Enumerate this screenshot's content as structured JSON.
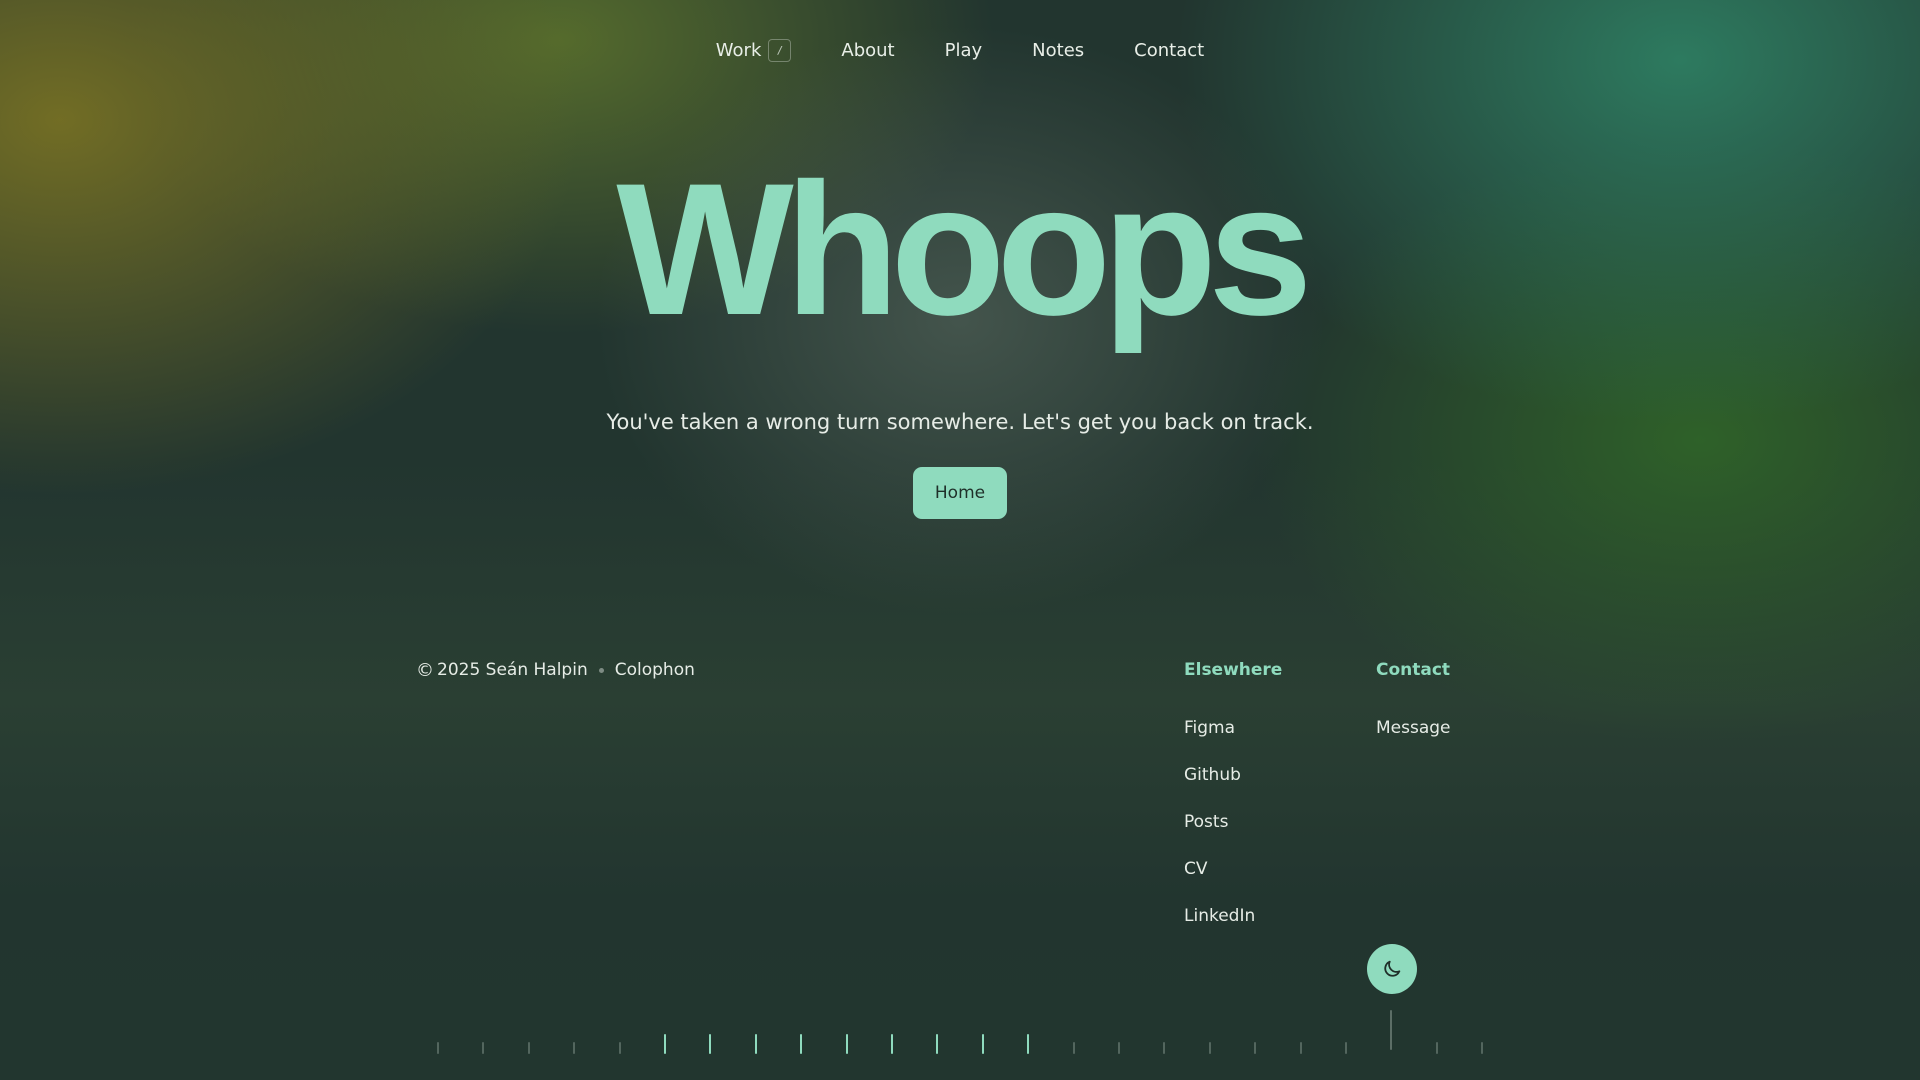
{
  "nav": {
    "items": [
      {
        "label": "Work",
        "shortcut": "/"
      },
      {
        "label": "About"
      },
      {
        "label": "Play"
      },
      {
        "label": "Notes"
      },
      {
        "label": "Contact"
      }
    ]
  },
  "hero": {
    "title": "Whoops",
    "subtitle": "You've taken a wrong turn somewhere. Let's get you back on track.",
    "button_label": "Home"
  },
  "footer": {
    "copyright_symbol": "©",
    "copyright_text": "2025 Seán Halpin",
    "colophon_label": "Colophon",
    "elsewhere": {
      "title": "Elsewhere",
      "links": [
        "Figma",
        "Github",
        "Posts",
        "CV",
        "LinkedIn"
      ]
    },
    "contact": {
      "title": "Contact",
      "links": [
        "Message"
      ]
    }
  },
  "theme_toggle": {
    "icon": "moon-icon"
  },
  "colors": {
    "accent": "#8fdbbe",
    "text": "#e6ece6",
    "button_text": "#1f2f29"
  }
}
